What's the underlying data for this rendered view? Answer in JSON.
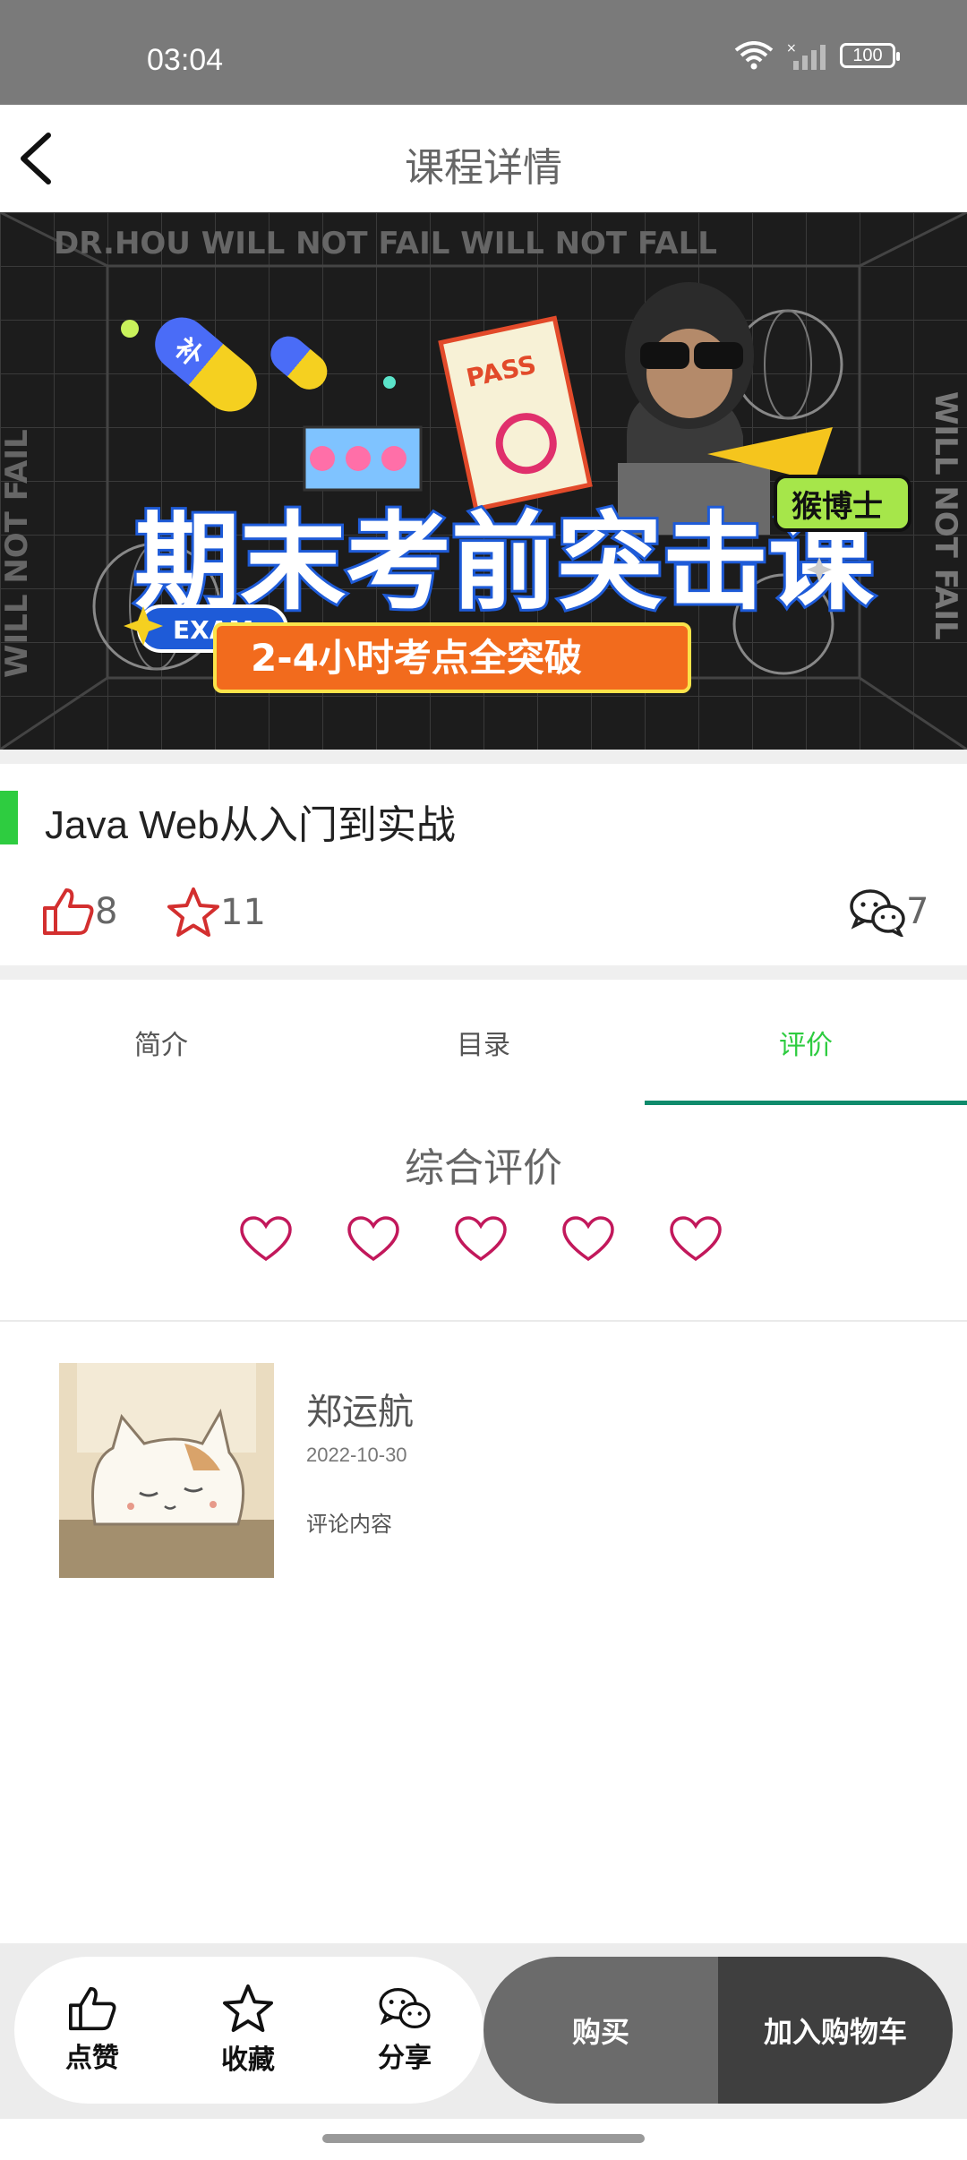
{
  "status_bar": {
    "time": "03:04",
    "battery": "100",
    "icons": [
      "wifi-icon",
      "signal-icon",
      "battery-icon"
    ]
  },
  "header": {
    "title": "课程详情",
    "back_icon": "chevron-left-icon"
  },
  "banner": {
    "top_text": "DR.HOU WILL NOT FAIL WILL NOT FALL",
    "side_text": "WILL NOT FAIL",
    "badge_pill": "补",
    "pass_text": "PASS",
    "main_text": "期末考前突击课",
    "exam_text": "EXAM",
    "brand_text": "猴博士",
    "subtitle": "2-4小时考点全突破"
  },
  "course": {
    "title": "Java Web从入门到实战",
    "likes": "8",
    "favorites": "11",
    "comments": "7"
  },
  "tabs": [
    {
      "label": "简介",
      "active": false
    },
    {
      "label": "目录",
      "active": false
    },
    {
      "label": "评价",
      "active": true
    }
  ],
  "rating": {
    "title": "综合评价",
    "value": 0,
    "max": 5
  },
  "reviews": [
    {
      "name": "郑运航",
      "date": "2022-10-30",
      "content": "评论内容"
    }
  ],
  "bottom_bar": {
    "like_label": "点赞",
    "favorite_label": "收藏",
    "share_label": "分享",
    "buy_label": "购买",
    "cart_label": "加入购物车"
  },
  "colors": {
    "accent_green": "#2ecc40",
    "tab_underline": "#0f8b6c",
    "heart": "#c2185b",
    "like_red": "#d32f2f"
  }
}
